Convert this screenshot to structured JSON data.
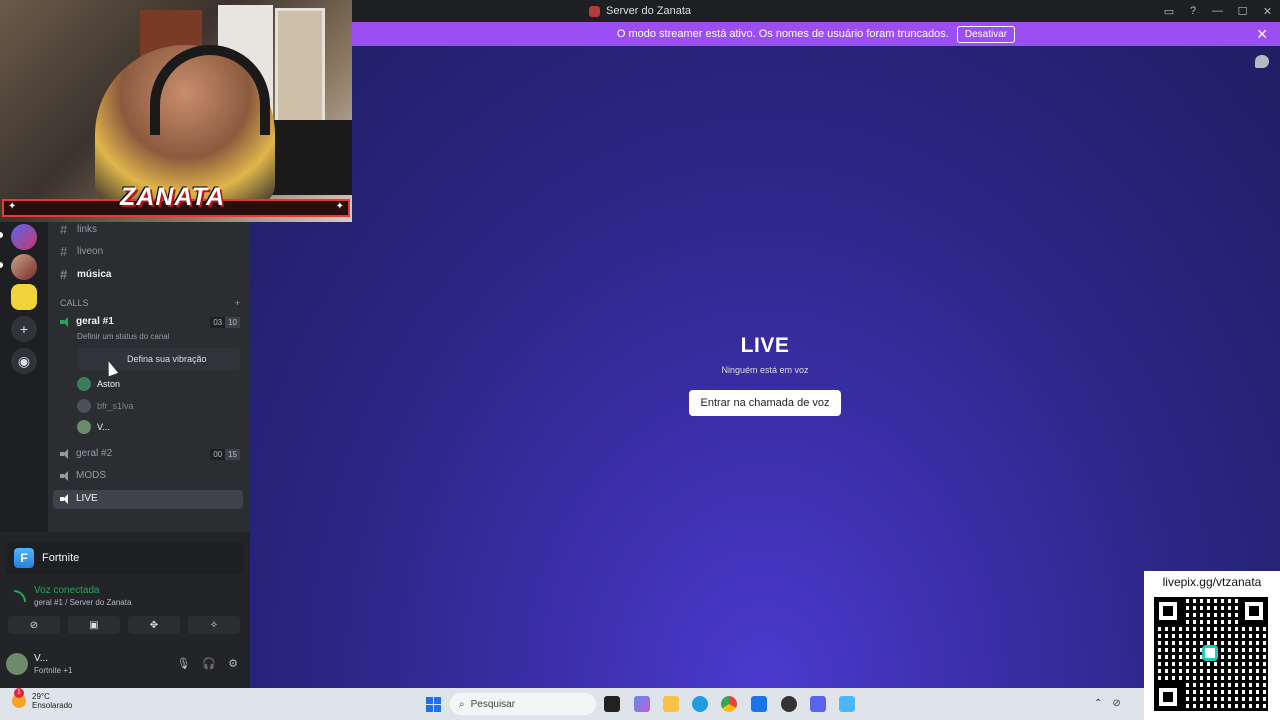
{
  "window": {
    "title": "Server do Zanata"
  },
  "banner": {
    "text": "O modo streamer está ativo. Os nomes de usuário foram truncados.",
    "button": "Desativar"
  },
  "overlay": {
    "logo": "ZANATA"
  },
  "channels": {
    "text": [
      {
        "name": "links"
      },
      {
        "name": "liveon"
      },
      {
        "name": "música"
      }
    ],
    "category": "CALLS",
    "voice": [
      {
        "name": "geral #1",
        "count_a": "03",
        "count_b": "10"
      },
      {
        "name": "geral #2",
        "count_a": "00",
        "count_b": "15"
      },
      {
        "name": "MODS"
      },
      {
        "name": "LIVE"
      }
    ],
    "status_hint": "Definir um status do canal",
    "vibe_button": "Defina sua vibração",
    "members": [
      "Aston",
      "bfr_s1lva",
      "V..."
    ]
  },
  "main": {
    "title": "LIVE",
    "subtitle": "Ninguém está em voz",
    "join_button": "Entrar na chamada de voz"
  },
  "panel": {
    "activity": "Fortnite",
    "voice_status": "Voz conectada",
    "voice_location": "geral #1 / Server do Zanata",
    "user_name": "V...",
    "user_game": "Fortnite +1"
  },
  "taskbar": {
    "temp": "29°C",
    "weather": "Ensolarado",
    "search_placeholder": "Pesquisar",
    "notification_count": "1"
  },
  "qr": {
    "url": "livepix.gg/vtzanata"
  },
  "colors": {
    "accent": "#9b4ff2",
    "connected": "#23a55a"
  }
}
